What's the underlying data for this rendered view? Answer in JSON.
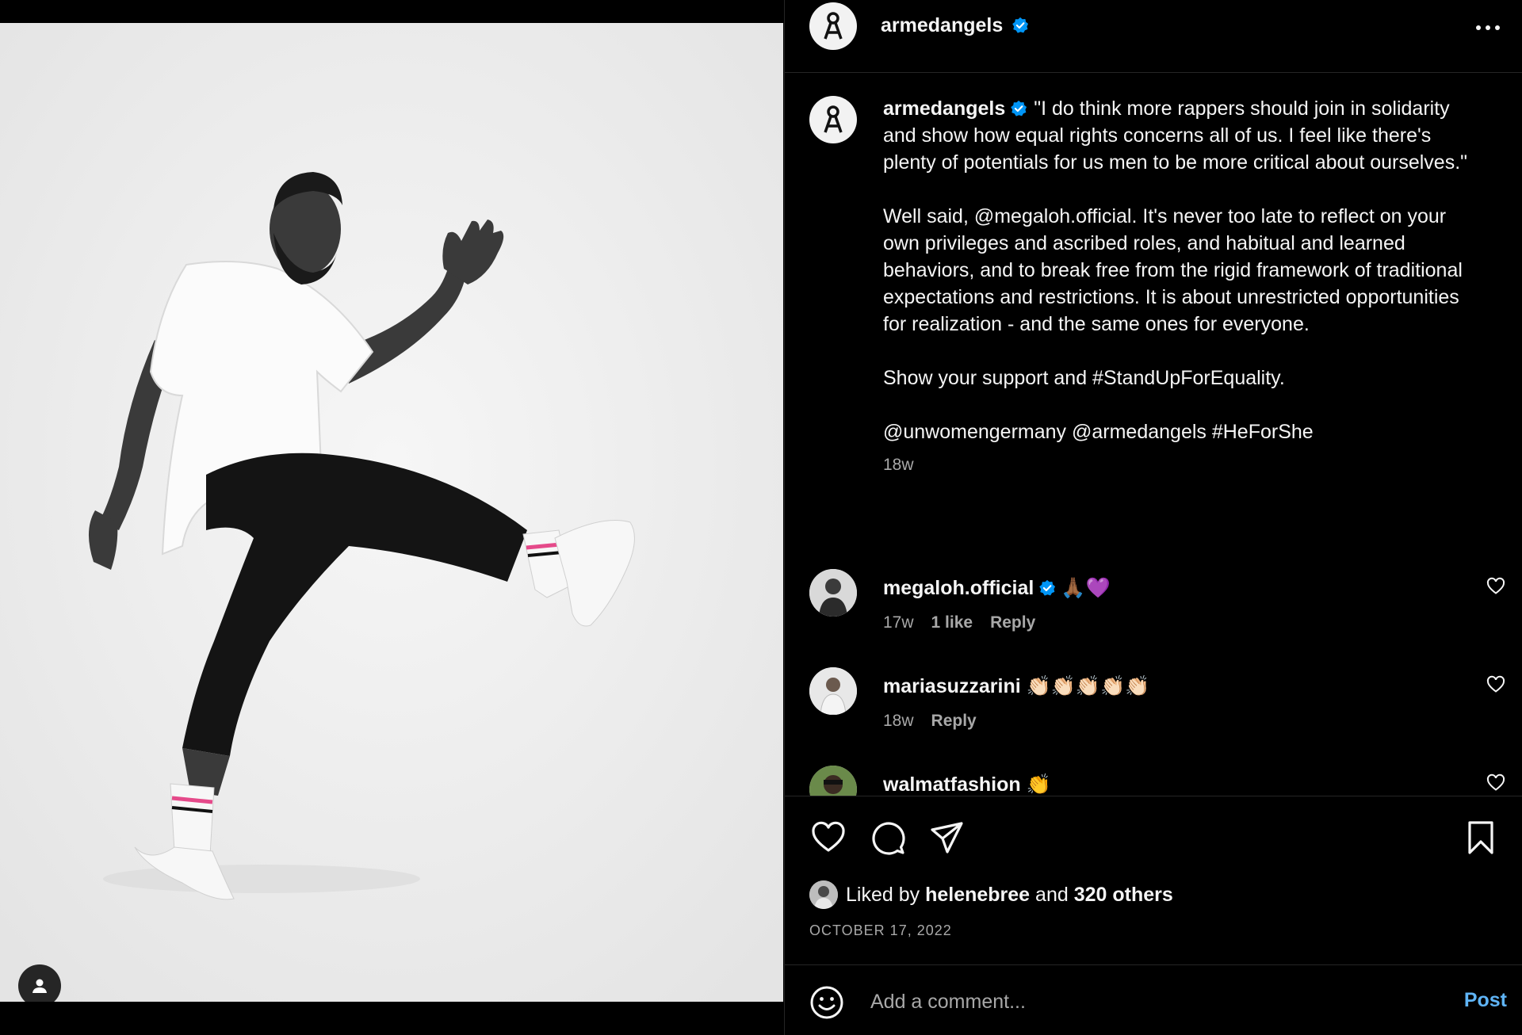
{
  "post": {
    "username": "armedangels",
    "verified": true,
    "more_icon": "more-horizontal-icon"
  },
  "caption": {
    "username": "armedangels",
    "paragraphs": [
      "\"I do think more rappers should join in solidarity and show how equal rights concerns all of us. I feel like there's plenty of potentials for us men to be more critical about ourselves.\"",
      "Well said, @megaloh.official. It's never too late to reflect on your own privileges and ascribed roles, and habitual and learned behaviors, and to break free from the rigid framework of traditional expectations and restrictions. It is about unrestricted opportunities for realization - and the same ones for everyone.",
      "Show your support and #StandUpForEquality.",
      "@unwomengermany @armedangels #HeForShe"
    ],
    "time": "18w"
  },
  "comments": [
    {
      "username": "megaloh.official",
      "verified": true,
      "text": "🙏🏾💜",
      "time": "17w",
      "likes": "1 like",
      "reply": "Reply"
    },
    {
      "username": "mariasuzzarini",
      "verified": false,
      "text": "👏🏻👏🏻👏🏻👏🏻👏🏻",
      "time": "18w",
      "reply": "Reply"
    },
    {
      "username": "walmatfashion",
      "verified": false,
      "text": "👏"
    }
  ],
  "likes": {
    "prefix": "Liked by",
    "user": "helenebree",
    "conj": "and",
    "others": "320 others"
  },
  "date": "OCTOBER 17, 2022",
  "add_comment": {
    "placeholder": "Add a comment...",
    "post_label": "Post"
  },
  "colors": {
    "background": "#000000",
    "text": "#f5f5f5",
    "secondary": "#a8a8a8",
    "link": "#5fb4f6",
    "verified": "#0095f6",
    "divider": "#262626"
  }
}
